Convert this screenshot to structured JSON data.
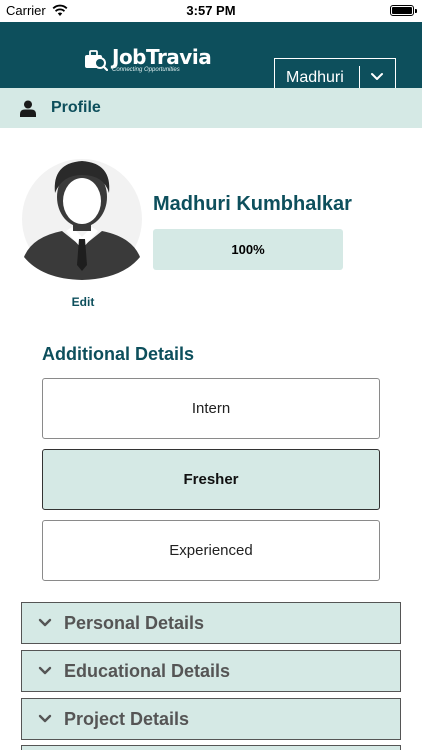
{
  "status_bar": {
    "carrier": "Carrier",
    "time": "3:57 PM"
  },
  "header": {
    "logo_title": "JobTravia",
    "logo_tagline": "Connecting Opportunities",
    "user_select": {
      "selected": "Madhuri"
    }
  },
  "profile_bar": {
    "title": "Profile"
  },
  "profile": {
    "edit_label": "Edit",
    "name": "Madhuri Kumbhalkar",
    "completion_label": "100%",
    "completion_fraction": 1.0
  },
  "additional_details": {
    "title": "Additional Details",
    "options": [
      {
        "label": "Intern",
        "selected": false
      },
      {
        "label": "Fresher",
        "selected": true
      },
      {
        "label": "Experienced",
        "selected": false
      }
    ]
  },
  "accordions": [
    {
      "label": "Personal Details"
    },
    {
      "label": "Educational Details"
    },
    {
      "label": "Project Details"
    }
  ],
  "colors": {
    "brand": "#0d4f5c",
    "accent_light": "#d5e9e5",
    "header_text": "#ffffff"
  },
  "icons": {
    "wifi": "wifi-icon",
    "battery": "battery-icon",
    "logo": "briefcase-search-icon",
    "dropdown": "chevron-down-icon",
    "profile": "person-icon",
    "avatar": "default-avatar-icon",
    "accordion": "chevron-down-icon"
  }
}
